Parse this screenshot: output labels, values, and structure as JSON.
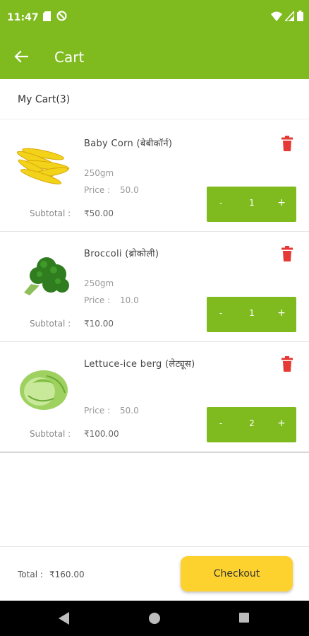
{
  "status_bar": {
    "time": "11:47"
  },
  "app_bar": {
    "title": "Cart"
  },
  "cart": {
    "heading": "My Cart(3)"
  },
  "items": [
    {
      "name": "Baby Corn (बेबीकॉर्न)",
      "weight": "250gm",
      "price_label": "Price :",
      "price": "50.0",
      "subtotal_label": "Subtotal :",
      "subtotal": "₹50.00",
      "quantity": "1",
      "image": "baby-corn-image"
    },
    {
      "name": "Broccoli (ब्रोकोली)",
      "weight": "250gm",
      "price_label": "Price :",
      "price": "10.0",
      "subtotal_label": "Subtotal :",
      "subtotal": "₹10.00",
      "quantity": "1",
      "image": "broccoli-image"
    },
    {
      "name": "Lettuce-ice berg (लेट्यूस)",
      "weight": "",
      "price_label": "Price :",
      "price": "50.0",
      "subtotal_label": "Subtotal :",
      "subtotal": "₹100.00",
      "quantity": "2",
      "image": "lettuce-image"
    }
  ],
  "qty_controls": {
    "minus": "-",
    "plus": "+"
  },
  "footer": {
    "total_label": "Total :",
    "total": "₹160.00",
    "checkout_label": "Checkout"
  },
  "colors": {
    "primary_green": "#7fbb1f",
    "checkout_yellow": "#fdd22e",
    "delete_red": "#e53935"
  }
}
